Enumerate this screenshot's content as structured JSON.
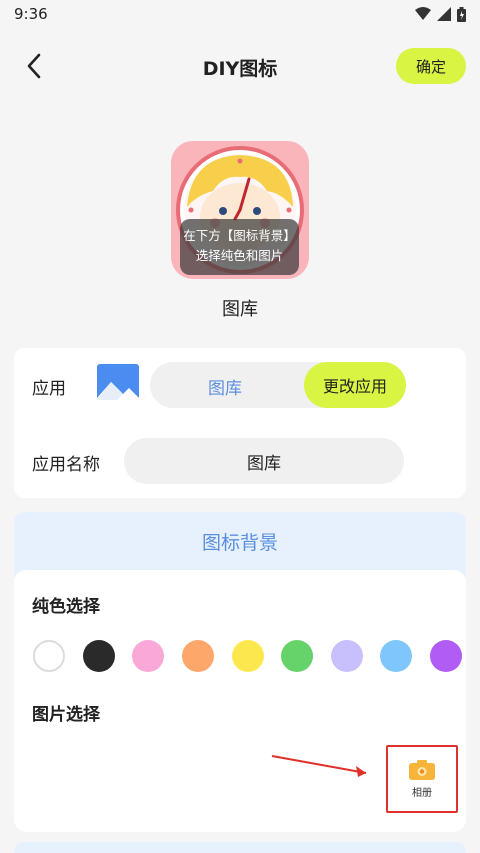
{
  "status": {
    "time": "9:36"
  },
  "header": {
    "title": "DIY图标",
    "confirm_label": "确定"
  },
  "preview": {
    "overlay_line1": "在下方【图标背景】",
    "overlay_line2": "选择纯色和图片",
    "name": "图库"
  },
  "app_card": {
    "app_label": "应用",
    "current_app": "图库",
    "change_app_label": "更改应用",
    "name_label": "应用名称",
    "name_value": "图库"
  },
  "bg_card": {
    "title": "图标背景",
    "solid_label": "纯色选择",
    "image_label": "图片选择",
    "album_label": "相册",
    "colors": [
      "#ffffff",
      "#2a2a2a",
      "#f9a8d8",
      "#fda76a",
      "#fde74f",
      "#66d26a",
      "#c7c0fc",
      "#7ec6fb",
      "#b05cf5"
    ]
  },
  "accent": {
    "lime": "#d9f443",
    "blue": "#5b8fe0",
    "annotation_red": "#e0302a"
  }
}
